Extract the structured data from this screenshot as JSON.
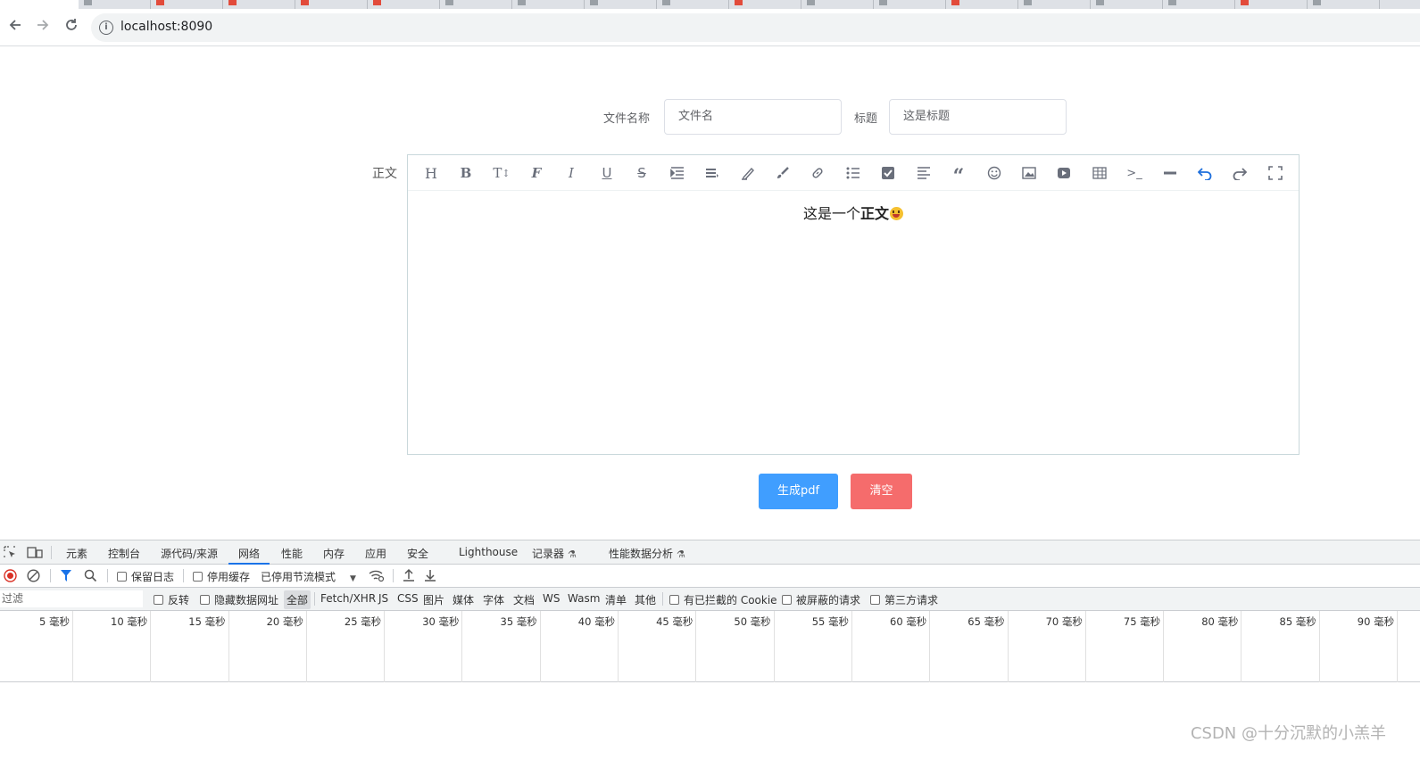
{
  "browser": {
    "url": "localhost:8090"
  },
  "form": {
    "filename_label": "文件名称",
    "filename_value": "文件名",
    "title_label": "标题",
    "title_value": "这是标题",
    "body_label": "正文",
    "body_text_plain": "这是一个",
    "body_text_bold": "正文",
    "generate_button": "生成pdf",
    "clear_button": "清空",
    "colors": {
      "generate": "#409eff",
      "clear": "#f56c6c",
      "editor_border": "#c9d8db"
    }
  },
  "editor_toolbar": [
    "heading-icon",
    "bold-icon",
    "font-size-icon",
    "font-family-icon",
    "italic-icon",
    "underline-icon",
    "strikethrough-icon",
    "indent-icon",
    "line-height-icon",
    "font-color-icon",
    "background-color-icon",
    "link-icon",
    "list-icon",
    "todo-icon",
    "justify-icon",
    "quote-icon",
    "emoticon-icon",
    "image-icon",
    "video-icon",
    "table-icon",
    "code-icon",
    "divider-icon",
    "undo-icon",
    "redo-icon",
    "fullscreen-icon"
  ],
  "devtools": {
    "tabs": [
      "元素",
      "控制台",
      "源代码/来源",
      "网络",
      "性能",
      "内存",
      "应用",
      "安全",
      "Lighthouse",
      "记录器",
      "性能数据分析"
    ],
    "active_tab": "网络",
    "toolbar": {
      "preserve_log": "保留日志",
      "disable_cache": "停用缓存",
      "throttling": "已停用节流模式"
    },
    "filter": {
      "placeholder": "过滤",
      "invert": "反转",
      "hide_data_urls": "隐藏数据网址",
      "types": [
        "全部",
        "Fetch/XHR",
        "JS",
        "CSS",
        "图片",
        "媒体",
        "字体",
        "文档",
        "WS",
        "Wasm",
        "清单",
        "其他"
      ],
      "blocked_cookies": "有已拦截的 Cookie",
      "blocked_requests": "被屏蔽的请求",
      "third_party": "第三方请求"
    },
    "timeline_ticks": [
      "5 毫秒",
      "10 毫秒",
      "15 毫秒",
      "20 毫秒",
      "25 毫秒",
      "30 毫秒",
      "35 毫秒",
      "40 毫秒",
      "45 毫秒",
      "50 毫秒",
      "55 毫秒",
      "60 毫秒",
      "65 毫秒",
      "70 毫秒",
      "75 毫秒",
      "80 毫秒",
      "85 毫秒",
      "90 毫秒"
    ]
  },
  "watermark": "CSDN @十分沉默的小羔羊"
}
